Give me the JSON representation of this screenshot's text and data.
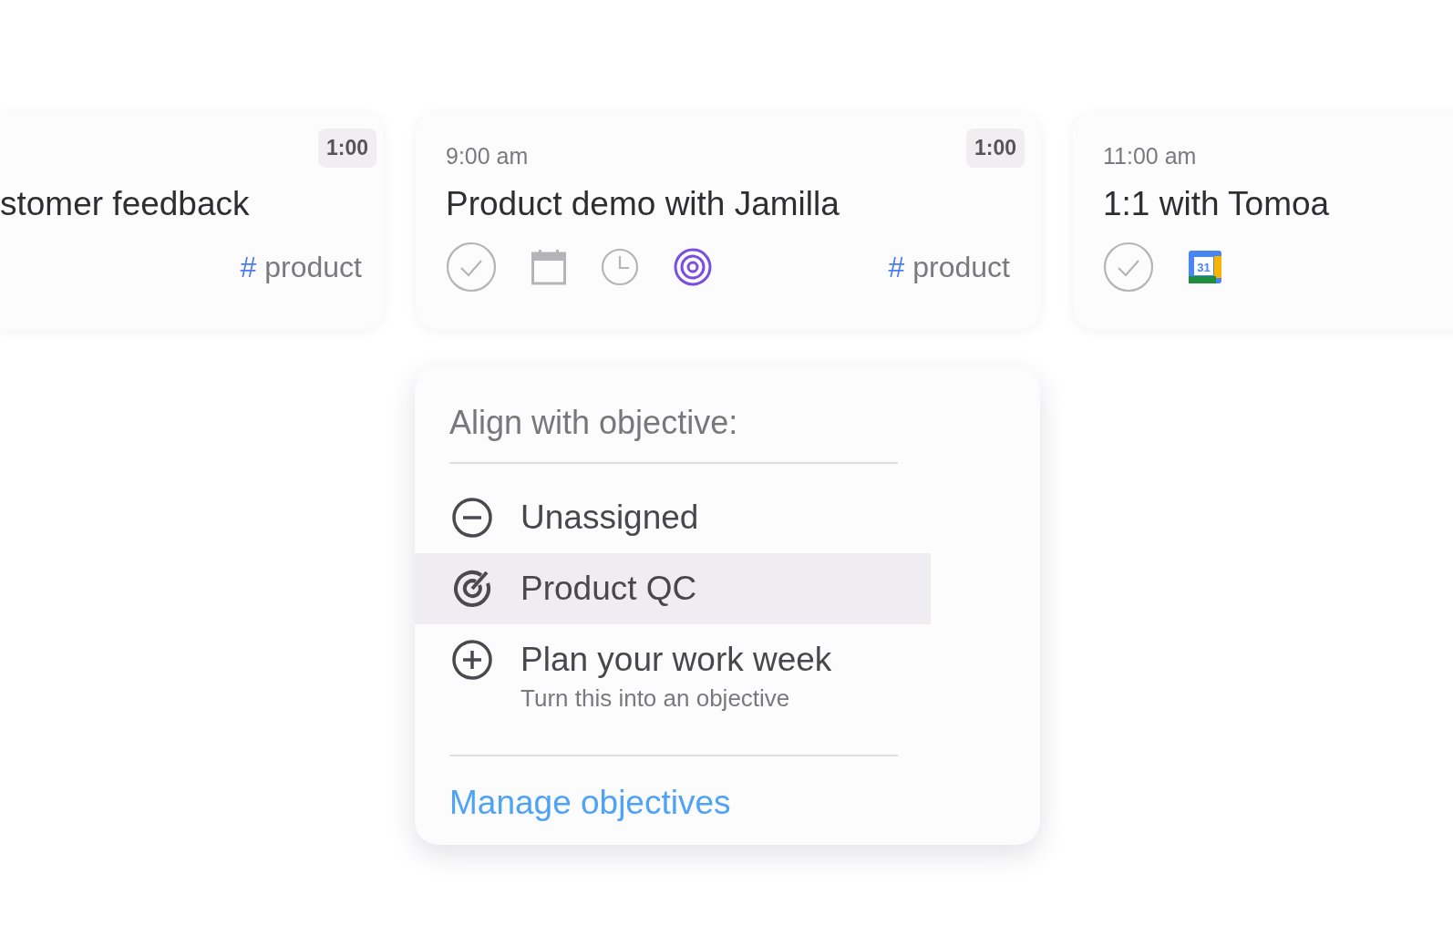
{
  "cards": [
    {
      "title": "stomer feedback",
      "duration": "1:00",
      "tag": {
        "symbol": "#",
        "label": "product"
      }
    },
    {
      "time": "9:00 am",
      "title": "Product demo with Jamilla",
      "duration": "1:00",
      "actions": [
        {
          "kind": "check"
        },
        {
          "kind": "calendar"
        },
        {
          "kind": "clock"
        },
        {
          "kind": "objective",
          "on": true
        }
      ],
      "tag": {
        "symbol": "#",
        "label": "product"
      }
    },
    {
      "time": "11:00 am",
      "title": "1:1 with Tomoa",
      "actions": [
        {
          "kind": "check"
        },
        {
          "kind": "google-calendar",
          "text": "31"
        }
      ]
    }
  ],
  "menu": {
    "heading": "Align with objective:",
    "options": [
      {
        "kind": "unassigned",
        "label": "Unassigned",
        "selected": false
      },
      {
        "kind": "objective",
        "label": "Product QC",
        "selected": true
      },
      {
        "kind": "create",
        "label": "Plan your work week",
        "subtitle": "Turn this into an objective",
        "selected": false
      }
    ],
    "link": "Manage objectives"
  }
}
